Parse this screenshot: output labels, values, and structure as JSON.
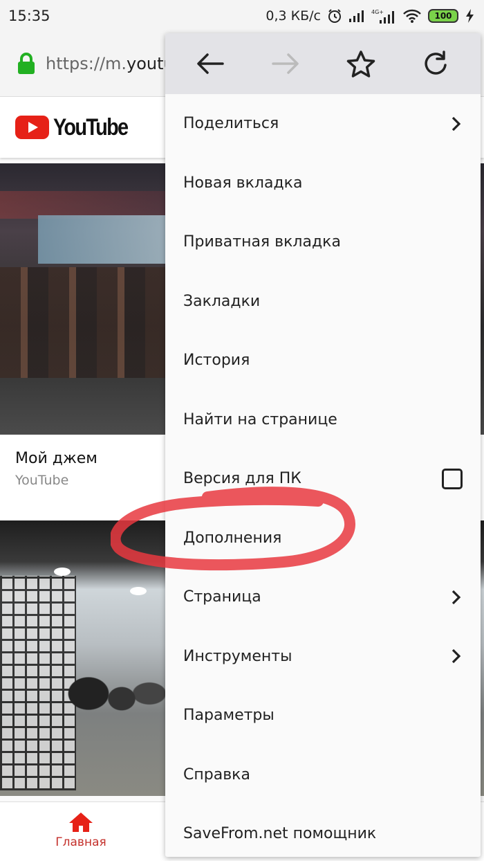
{
  "status_bar": {
    "time": "15:35",
    "net_speed": "0,3 КБ/с",
    "icons": [
      "alarm-icon",
      "signal-icon",
      "signal-4g-icon",
      "wifi-icon"
    ],
    "network_type": "4G+",
    "battery": "100",
    "battery_color": "#7ad34a"
  },
  "url_bar": {
    "scheme": "https://m.",
    "host_visible": "youtul",
    "lock_color": "#22b022"
  },
  "youtube": {
    "logo_text": "YouTube",
    "brand_color": "#e62117",
    "video": {
      "title": "Мой джем",
      "channel": "YouTube"
    },
    "bottom_nav": {
      "home_label": "Главная",
      "active_color": "#c4302b"
    }
  },
  "menu": {
    "toolbar": {
      "back": "back-icon",
      "forward": "forward-icon",
      "bookmark": "star-icon",
      "reload": "reload-icon"
    },
    "items": [
      {
        "label": "Поделиться",
        "trailing": "chevron"
      },
      {
        "label": "Новая вкладка",
        "trailing": ""
      },
      {
        "label": "Приватная вкладка",
        "trailing": ""
      },
      {
        "label": "Закладки",
        "trailing": ""
      },
      {
        "label": "История",
        "trailing": ""
      },
      {
        "label": "Найти на странице",
        "trailing": ""
      },
      {
        "label": "Версия для ПК",
        "trailing": "checkbox",
        "checked": false
      },
      {
        "label": "Дополнения",
        "trailing": "",
        "highlighted": true
      },
      {
        "label": "Страница",
        "trailing": "chevron"
      },
      {
        "label": "Инструменты",
        "trailing": "chevron"
      },
      {
        "label": "Параметры",
        "trailing": ""
      },
      {
        "label": "Справка",
        "trailing": ""
      },
      {
        "label": "SaveFrom.net помощник",
        "trailing": ""
      }
    ],
    "annotation_color": "#e8383f"
  }
}
